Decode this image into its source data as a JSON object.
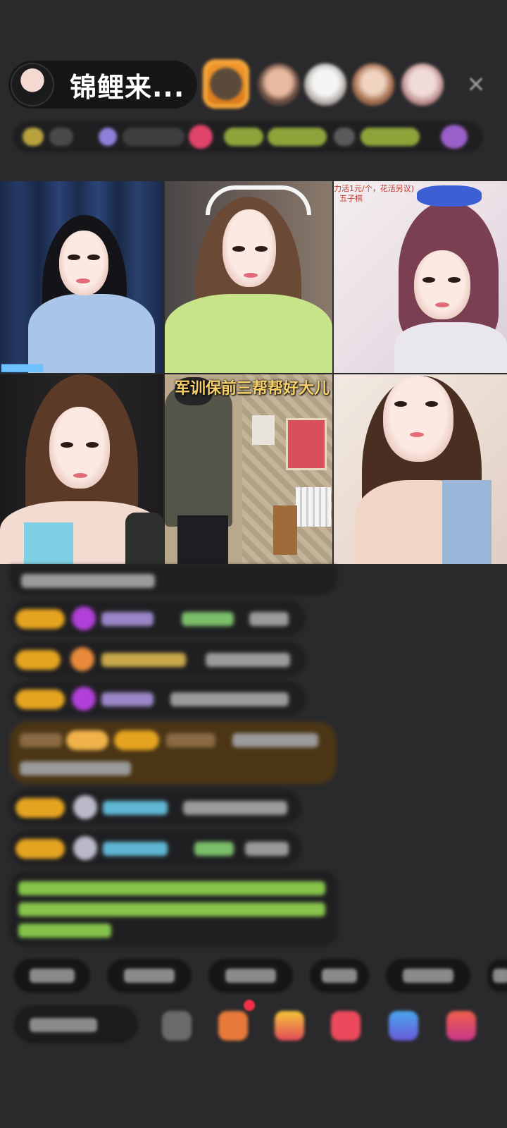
{
  "header": {
    "host_name": "锦鲤来..."
  },
  "close_icon": "close-icon",
  "video_tiles": [
    {
      "overlay": ""
    },
    {
      "overlay": ""
    },
    {
      "overlay": "力活1元/个，花活另议)",
      "subtitle": "五子棋"
    },
    {
      "overlay": ""
    },
    {
      "overlay": "军训保前三帮帮好大儿"
    },
    {
      "overlay": ""
    }
  ],
  "colors": {
    "background": "#2a2a2c",
    "badge_gold": "#e5a420",
    "name_purple": "#b48bd8",
    "name_green": "#7bbf6a",
    "name_blue": "#5fb7d4",
    "system_green": "#86c44a",
    "gift_row_bg": "#4a3515"
  }
}
